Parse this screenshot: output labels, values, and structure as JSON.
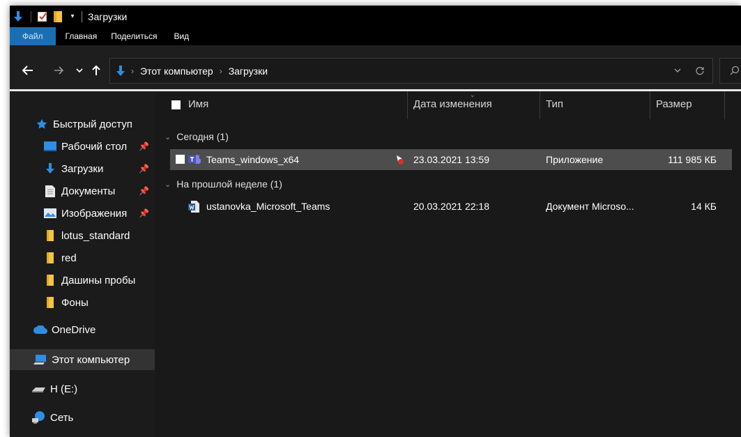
{
  "window": {
    "title": "Загрузки"
  },
  "ribbon": {
    "tabs": [
      "Файл",
      "Главная",
      "Поделиться",
      "Вид"
    ]
  },
  "address": {
    "crumbs": [
      "Этот компьютер",
      "Загрузки"
    ]
  },
  "columns": [
    "Имя",
    "Дата изменения",
    "Тип",
    "Размер"
  ],
  "nav": {
    "quick_access": "Быстрый доступ",
    "items": [
      {
        "label": "Рабочий стол",
        "icon": "desktop-icon",
        "pinned": true
      },
      {
        "label": "Загрузки",
        "icon": "download-arrow-icon",
        "pinned": true
      },
      {
        "label": "Документы",
        "icon": "documents-icon",
        "pinned": true
      },
      {
        "label": "Изображения",
        "icon": "pictures-icon",
        "pinned": true
      },
      {
        "label": "lotus_standard",
        "icon": "folder-icon",
        "pinned": false
      },
      {
        "label": "red",
        "icon": "folder-icon",
        "pinned": false
      },
      {
        "label": "Дашины пробы",
        "icon": "folder-icon",
        "pinned": false
      },
      {
        "label": "Фоны",
        "icon": "folder-icon",
        "pinned": false
      }
    ],
    "onedrive": "OneDrive",
    "this_pc": "Этот компьютер",
    "drive": "H (E:)",
    "network": "Сеть"
  },
  "groups": [
    {
      "label": "Сегодня (1)",
      "files": [
        {
          "name": "Teams_windows_x64",
          "date": "23.03.2021 13:59",
          "type": "Приложение",
          "size": "111 985 КБ",
          "icon": "teams-icon",
          "selected": true
        }
      ]
    },
    {
      "label": "На прошлой неделе (1)",
      "files": [
        {
          "name": "ustanovka_Microsoft_Teams",
          "date": "20.03.2021 22:18",
          "type": "Документ Microso...",
          "size": "14 КБ",
          "icon": "word-doc-icon",
          "selected": false
        }
      ]
    }
  ],
  "colors": {
    "accent": "#1a6fb3",
    "folder": "#f4c542",
    "selection": "#4d4d4d",
    "background": "#191919"
  }
}
